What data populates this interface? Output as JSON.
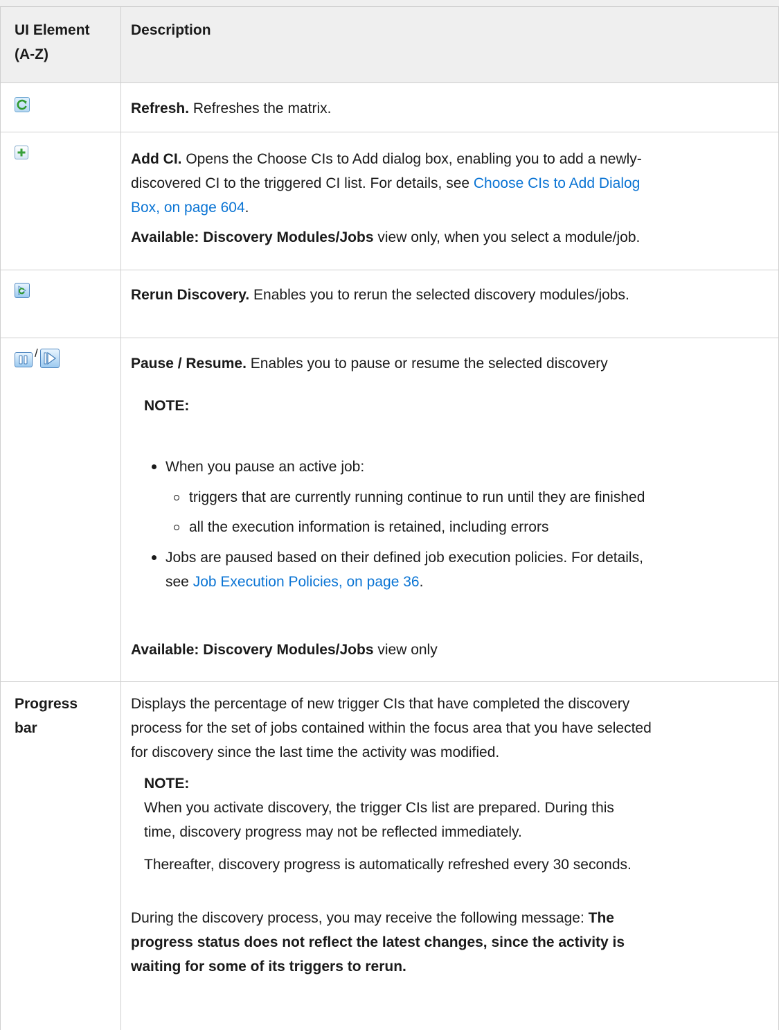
{
  "table": {
    "header": {
      "col1_line1": "UI Element",
      "col1_line2": "(A-Z)",
      "col2": "Description"
    },
    "rows": {
      "refresh": {
        "icon": "refresh-icon",
        "title": "Refresh.",
        "text": " Refreshes the matrix."
      },
      "add_ci": {
        "icon": "add-icon",
        "title": "Add CI.",
        "line1": " Opens the Choose CIs to Add dialog box, enabling you to add a newly-",
        "line2": "discovered CI to the triggered CI list. For details, see ",
        "link_part1": "Choose CIs to Add Dialog",
        "link_part2": "Box, on page 604",
        "after_link": ".",
        "available_label": "Available: Discovery Modules/Jobs",
        "available_text": " view only, when you select a module/job."
      },
      "rerun": {
        "icon": "rerun-discovery-icon",
        "title": "Rerun Discovery.",
        "text": " Enables you to rerun the selected discovery modules/jobs."
      },
      "pause_resume": {
        "icon_pause": "pause-icon",
        "separator": "/",
        "icon_resume": "resume-icon",
        "title": "Pause / Resume.",
        "text": " Enables you to pause or resume the selected discovery",
        "note_label": "NOTE:",
        "bullet1": "When you pause an active job:",
        "sub1": "triggers that are currently running continue to run until they are finished",
        "sub2": "all the execution information is retained, including errors",
        "bullet2_line1": "Jobs are paused based on their defined job execution policies. For details,",
        "bullet2_line2": "see ",
        "bullet2_link": "Job Execution Policies, on page 36",
        "bullet2_after": ".",
        "available_label": "Available: Discovery Modules/Jobs",
        "available_text": " view only"
      },
      "progress": {
        "name_line1": "Progress",
        "name_line2": "bar",
        "desc_line1": "Displays the percentage of new trigger CIs that have completed the discovery",
        "desc_line2": "process for the set of jobs contained within the focus area that you have selected",
        "desc_line3": "for discovery since the last time the activity was modified.",
        "note_label": "NOTE:",
        "note_line1": "When you activate discovery, the trigger CIs list are prepared. During this",
        "note_line2": "time, discovery progress may not be reflected immediately.",
        "note_line3": "Thereafter, discovery progress is automatically refreshed every 30 seconds.",
        "msg_line1": "During the discovery process, you may receive the following message: ",
        "msg_bold1": "The",
        "msg_bold2": "progress status does not reflect the latest changes, since the activity is",
        "msg_bold3": "waiting for some of its triggers to rerun."
      }
    }
  }
}
